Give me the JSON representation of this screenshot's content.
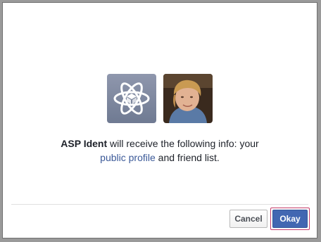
{
  "dialog": {
    "app_icon": "atom-icon",
    "message": {
      "app_name": "ASP Ident",
      "line1_rest": " will receive the following info: your",
      "link": "public profile",
      "line2_rest": " and friend list."
    },
    "buttons": {
      "cancel": "Cancel",
      "okay": "Okay"
    }
  },
  "colors": {
    "link": "#3b5998",
    "primary_button": "#4267b2",
    "focus_ring": "#c43c6a"
  }
}
